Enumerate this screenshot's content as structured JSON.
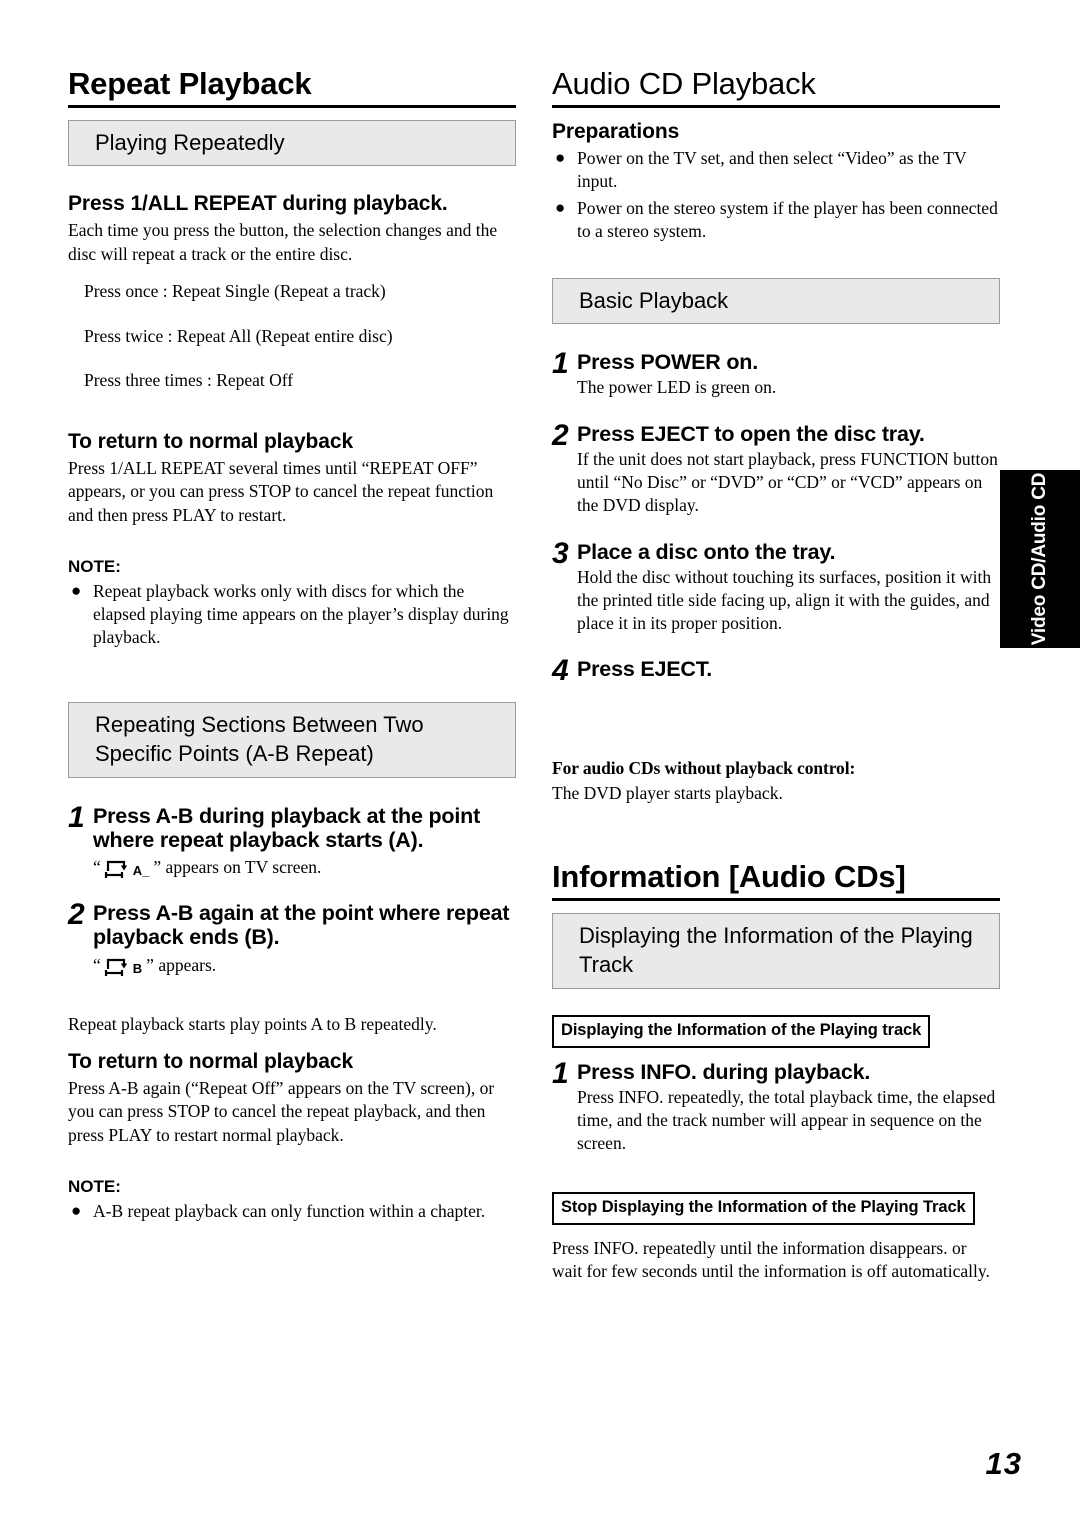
{
  "page": {
    "number": "13",
    "side_tab_label": "Video CD/Audio CD"
  },
  "left_column": {
    "chapter_title": "Repeat Playback",
    "section1": {
      "band_title": "Playing Repeatedly",
      "subhead": "Press 1/ALL REPEAT during playback.",
      "body": "Each time you press the button, the selection changes and the disc will repeat a track or the entire disc.",
      "press_lines": [
        "Press once : Repeat Single (Repeat a track)",
        "Press twice : Repeat All (Repeat entire disc)",
        "Press three times : Repeat Off"
      ],
      "return_heading": "To return to normal playback",
      "return_body": "Press 1/ALL REPEAT several times until “REPEAT OFF” appears, or  you can press STOP to cancel the repeat function and then press PLAY to restart.",
      "note_label": "NOTE:",
      "note_items": [
        "Repeat playback works only with discs for which the elapsed playing time appears on the player’s display during playback."
      ]
    },
    "section2": {
      "band_title": "Repeating Sections Between Two Specific Points (A-B Repeat)",
      "steps": [
        {
          "num": "1",
          "title": "Press A-B during playback at the point where repeat playback starts (A).",
          "icon_prefix": "“",
          "icon_sub": "A_",
          "icon_suffix": "” appears on TV screen."
        },
        {
          "num": "2",
          "title": "Press A-B again at the point where repeat playback ends (B).",
          "icon_prefix": "“",
          "icon_sub": "B",
          "icon_suffix": "” appears."
        }
      ],
      "after_steps_body": "Repeat playback starts play points A to B repeatedly.",
      "return_heading": "To return to normal playback",
      "return_body": "Press A-B again (“Repeat Off” appears on the TV screen), or you can press STOP to cancel the repeat playback, and then press PLAY to restart normal playback.",
      "note_label": "NOTE:",
      "note_items": [
        "A-B repeat playback can only function within a chapter."
      ]
    }
  },
  "right_column": {
    "chapter_title": "Audio CD Playback",
    "preparations": {
      "heading": "Preparations",
      "items": [
        "Power on the TV set, and then select “Video” as the TV input.",
        "Power on the stereo system if the player has been connected to a stereo system."
      ]
    },
    "basic_playback": {
      "band_title": "Basic Playback",
      "steps": [
        {
          "num": "1",
          "title": "Press POWER on.",
          "desc": "The power LED is green on."
        },
        {
          "num": "2",
          "title": "Press EJECT to open the disc tray.",
          "desc": "If the unit does not start playback, press FUNCTION button until “No Disc” or “DVD” or “CD” or “VCD” appears on the DVD display."
        },
        {
          "num": "3",
          "title": "Place a disc onto the tray.",
          "desc": "Hold the disc without touching its surfaces, position it with the printed title side facing up, align it with the guides, and place it in its proper position."
        },
        {
          "num": "4",
          "title": "Press EJECT.",
          "desc": ""
        }
      ],
      "footnote_heading": "For audio CDs without playback control:",
      "footnote_body": "The DVD player starts playback."
    },
    "information": {
      "chapter_title": "Information [Audio CDs]",
      "band_title": "Displaying the Information of the Playing Track",
      "boxed_heading_1": "Displaying the Information of  the Playing track",
      "step": {
        "num": "1",
        "title": "Press INFO. during playback.",
        "desc": "Press INFO. repeatedly, the total playback time, the elapsed time, and the track number will appear in sequence on the screen."
      },
      "boxed_heading_2": "Stop Displaying the Information of the Playing Track",
      "stop_body": "Press INFO. repeatedly until the information disappears. or wait for few seconds until the information is off automatically."
    }
  }
}
